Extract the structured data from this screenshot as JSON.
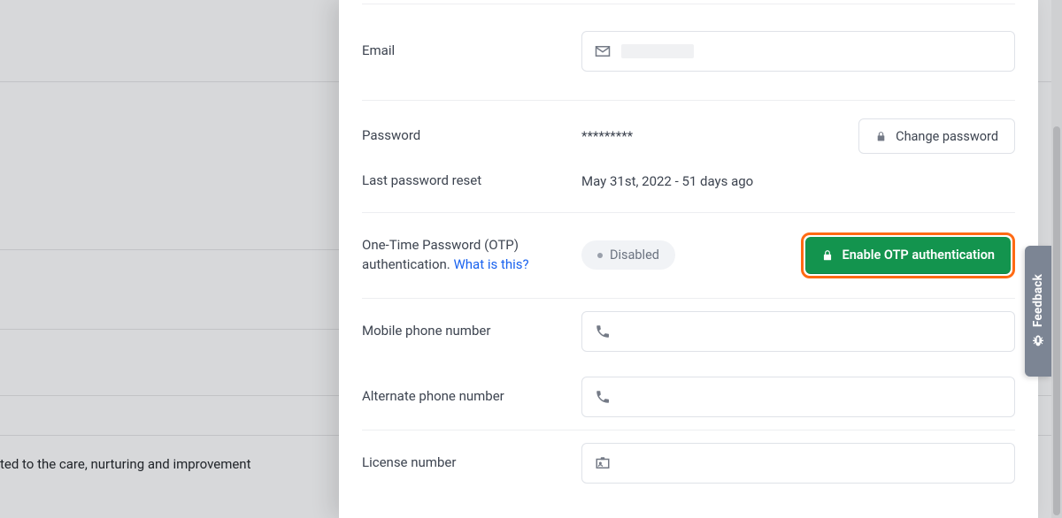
{
  "bg": {
    "partial_text": "ted to the care, nurturing and improvement"
  },
  "feedback": {
    "label": "Feedback"
  },
  "rows": {
    "email": {
      "label": "Email",
      "value": ""
    },
    "password": {
      "label": "Password",
      "masked": "*********",
      "change_btn": "Change password"
    },
    "last_reset": {
      "label": "Last password reset",
      "value": "May 31st, 2022 - 51 days ago"
    },
    "otp": {
      "label_a": "One-Time Password (OTP) authentication. ",
      "link": "What is this?",
      "status": "Disabled",
      "enable_btn": "Enable OTP authentication"
    },
    "mobile": {
      "label": "Mobile phone number",
      "value": ""
    },
    "alt_phone": {
      "label": "Alternate phone number",
      "value": ""
    },
    "license": {
      "label": "License number",
      "value": ""
    }
  }
}
